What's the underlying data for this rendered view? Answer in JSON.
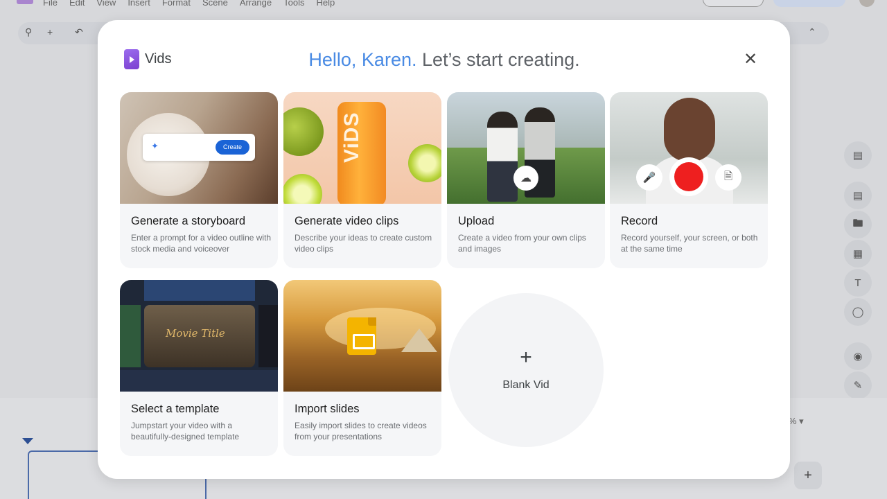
{
  "background": {
    "menu": [
      "File",
      "Edit",
      "View",
      "Insert",
      "Format",
      "Scene",
      "Arrange",
      "Tools",
      "Help"
    ],
    "zoom_suffix": "%"
  },
  "modal": {
    "brand": "Vids",
    "greeting": "Hello, Karen.",
    "headline_rest": " Let’s start creating.",
    "close_icon": "✕",
    "cards": [
      {
        "title": "Generate a storyboard",
        "description": "Enter a prompt for a video outline with stock media and voiceover",
        "image_button": "Create"
      },
      {
        "title": "Generate video clips",
        "description": "Describe your ideas to create custom video clips",
        "image_text": "ViDS"
      },
      {
        "title": "Upload",
        "description": "Create a video from your own clips and images"
      },
      {
        "title": "Record",
        "description": "Record yourself, your screen, or both at the same time"
      },
      {
        "title": "Select a template",
        "description": "Jumpstart your video with a beautifully-designed template",
        "image_text": "Movie Title"
      },
      {
        "title": "Import slides",
        "description": "Easily import slides to create videos from your presentations"
      }
    ],
    "blank": {
      "plus": "+",
      "label": "Blank Vid"
    }
  },
  "colors": {
    "greeting": "#4a8be4",
    "record": "#ee1f1f",
    "create_button": "#1a63d6"
  }
}
